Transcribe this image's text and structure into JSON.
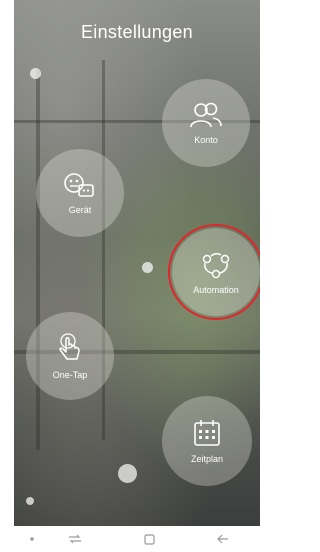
{
  "header": {
    "title": "Einstellungen"
  },
  "tiles": {
    "konto": {
      "label": "Konto",
      "icon": "users-icon"
    },
    "geraet": {
      "label": "Gerät",
      "icon": "device-plug-icon"
    },
    "automation": {
      "label": "Automation",
      "icon": "automation-cycle-icon",
      "highlighted": true,
      "highlight_color": "#e0262c"
    },
    "onetap": {
      "label": "One-Tap",
      "icon": "tap-finger-icon"
    },
    "zeitplan": {
      "label": "Zeitplan",
      "icon": "calendar-icon"
    }
  },
  "pager": {
    "pages": 4,
    "active": 3
  },
  "navbar": {
    "items": [
      "dot-icon",
      "recents-icon",
      "home-square-icon",
      "back-arrow-icon"
    ]
  }
}
